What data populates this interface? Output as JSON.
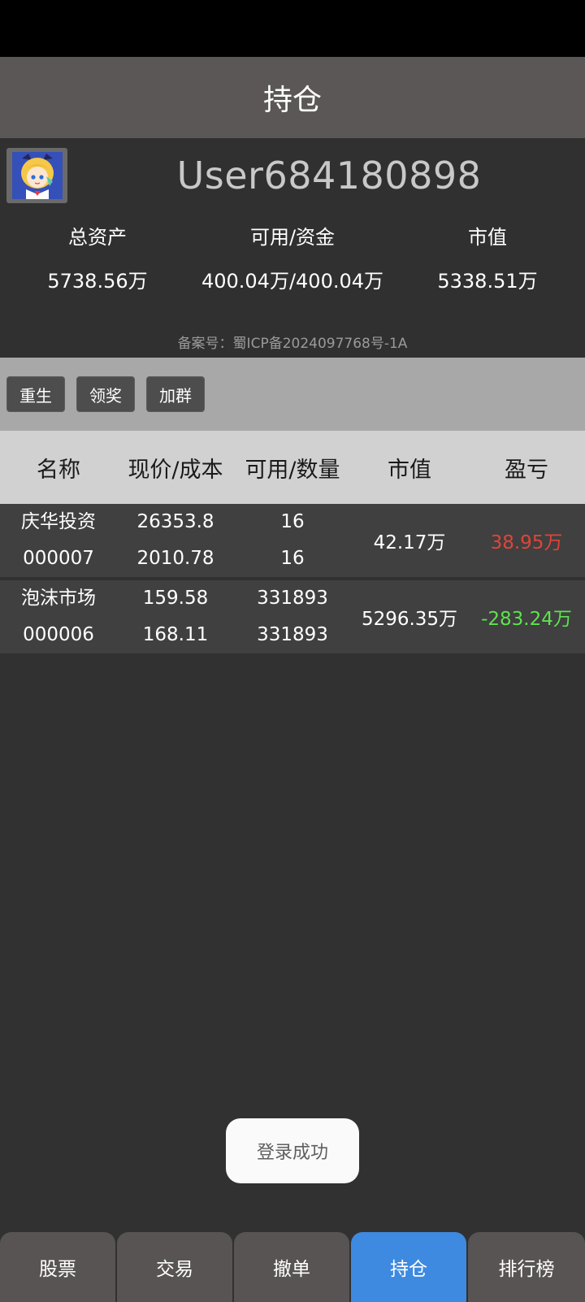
{
  "app": {
    "title": "持仓"
  },
  "profile": {
    "username": "User684180898",
    "avatar_icon": "anime-girl-avatar",
    "stats": [
      {
        "label": "总资产",
        "value": "5738.56万"
      },
      {
        "label": "可用/资金",
        "value": "400.04万/400.04万"
      },
      {
        "label": "市值",
        "value": "5338.51万"
      }
    ],
    "icp": "备案号：蜀ICP备2024097768号-1A"
  },
  "actions": [
    {
      "label": "重生"
    },
    {
      "label": "领奖"
    },
    {
      "label": "加群"
    }
  ],
  "table": {
    "headers": [
      "名称",
      "现价/成本",
      "可用/数量",
      "市值",
      "盈亏"
    ],
    "rows": [
      {
        "name": "庆华投资",
        "code": "000007",
        "price": "26353.8",
        "cost": "2010.78",
        "available": "16",
        "quantity": "16",
        "market_value": "42.17万",
        "pnl": "38.95万"
      },
      {
        "name": "泡沫市场",
        "code": "000006",
        "price": "159.58",
        "cost": "168.11",
        "available": "331893",
        "quantity": "331893",
        "market_value": "5296.35万",
        "pnl": "-283.24万"
      }
    ]
  },
  "toast": {
    "message": "登录成功"
  },
  "nav": {
    "items": [
      {
        "label": "股票"
      },
      {
        "label": "交易"
      },
      {
        "label": "撤单"
      },
      {
        "label": "持仓"
      },
      {
        "label": "排行榜"
      }
    ],
    "active_index": 3
  },
  "colors": {
    "gain": "#5ee24f",
    "loss": "#e0443a",
    "nav_active": "#3e8ae0"
  }
}
